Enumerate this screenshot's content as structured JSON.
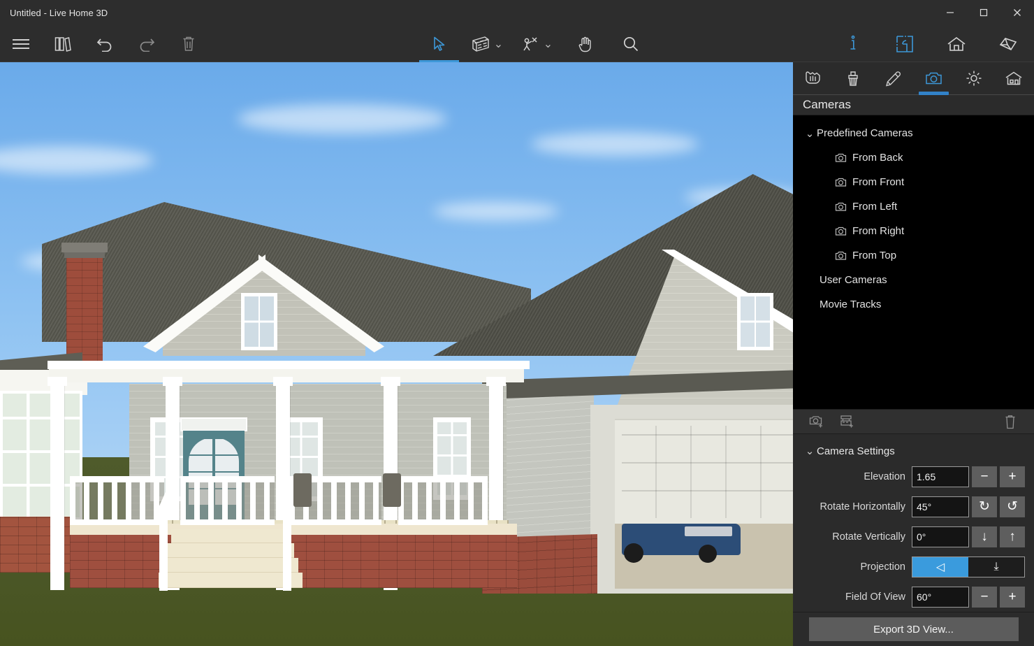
{
  "window": {
    "title": "Untitled - Live Home 3D",
    "minimize": "minimize-button",
    "maximize": "maximize-button",
    "close": "close-button"
  },
  "toolbar": {
    "left": [
      {
        "name": "menu-icon",
        "label": "Menu"
      },
      {
        "name": "library-icon",
        "label": "Library"
      },
      {
        "name": "undo-icon",
        "label": "Undo"
      },
      {
        "name": "redo-icon",
        "label": "Redo"
      },
      {
        "name": "delete-icon",
        "label": "Delete"
      }
    ],
    "center": [
      {
        "name": "select-tool",
        "label": "Select",
        "active": true
      },
      {
        "name": "wall-tool",
        "label": "Walls",
        "caret": "⌄"
      },
      {
        "name": "dimension-tool",
        "label": "Dimensions",
        "caret": "⌄"
      },
      {
        "name": "pan-tool",
        "label": "Pan"
      },
      {
        "name": "zoom-tool",
        "label": "Zoom"
      }
    ],
    "right": [
      {
        "name": "inspector-tab",
        "label": "Inspector",
        "selected": true
      },
      {
        "name": "floorplan-tab",
        "label": "Floor Plan",
        "selected": true
      },
      {
        "name": "elevation-tab",
        "label": "Elevation"
      },
      {
        "name": "view3d-tab",
        "label": "3D View"
      }
    ]
  },
  "panel": {
    "tabs": [
      {
        "name": "object-tab",
        "label": "Object"
      },
      {
        "name": "material-tab",
        "label": "Material"
      },
      {
        "name": "edit-tab",
        "label": "Edit"
      },
      {
        "name": "cameras-tab",
        "label": "Cameras",
        "active": true
      },
      {
        "name": "light-tab",
        "label": "Light"
      },
      {
        "name": "site-tab",
        "label": "Site"
      }
    ],
    "title": "Cameras",
    "tree": {
      "group_label": "Predefined Cameras",
      "group_expanded": true,
      "chevron": "⌄",
      "cameras": [
        "From Back",
        "From Front",
        "From Left",
        "From Right",
        "From Top"
      ],
      "user_cameras": "User Cameras",
      "movie_tracks": "Movie Tracks"
    },
    "list_toolbar": [
      {
        "name": "add-camera-icon",
        "label": "Add Camera"
      },
      {
        "name": "add-movie-track-icon",
        "label": "Add Movie Track"
      },
      {
        "name": "delete-icon",
        "label": "Delete"
      }
    ],
    "settings": {
      "header": "Camera Settings",
      "chevron": "⌄",
      "rows": [
        {
          "name": "elevation",
          "label": "Elevation",
          "value": "1.65",
          "buttons": [
            {
              "name": "decrement-button",
              "glyph": "−"
            },
            {
              "name": "increment-button",
              "glyph": "+"
            }
          ]
        },
        {
          "name": "rotate-horizontally",
          "label": "Rotate Horizontally",
          "value": "45°",
          "buttons": [
            {
              "name": "rotate-clockwise-button",
              "glyph": "↻"
            },
            {
              "name": "rotate-counterclockwise-button",
              "glyph": "↺"
            }
          ]
        },
        {
          "name": "rotate-vertically",
          "label": "Rotate Vertically",
          "value": "0°",
          "buttons": [
            {
              "name": "rotate-down-button",
              "glyph": "↓"
            },
            {
              "name": "rotate-up-button",
              "glyph": "↑"
            }
          ]
        }
      ],
      "projection": {
        "label": "Projection",
        "options": [
          {
            "name": "perspective-projection",
            "glyph": "◁",
            "selected": true
          },
          {
            "name": "orthographic-projection",
            "glyph": "⤓",
            "selected": false
          }
        ]
      },
      "field_of_view": {
        "label": "Field Of View",
        "value": "60°",
        "buttons": [
          {
            "name": "decrement-button",
            "glyph": "−"
          },
          {
            "name": "increment-button",
            "glyph": "+"
          }
        ]
      }
    },
    "export_button": "Export 3D View..."
  },
  "viewport": {
    "name": "3d-viewport",
    "scene": "Exterior rendering of a two-story house with front porch, dormer, brick chimney, attached garage with blue car, and green lawn"
  },
  "colors": {
    "accent": "#3282c8",
    "panel_bg": "#2b2b2b",
    "tree_bg": "#000000",
    "titlebar_bg": "#2d2d2d",
    "sky": "#8ec2f2",
    "grass": "#4b5728",
    "brick": "#9f4f3f",
    "siding": "#c9cbc2",
    "door": "#54838a"
  }
}
